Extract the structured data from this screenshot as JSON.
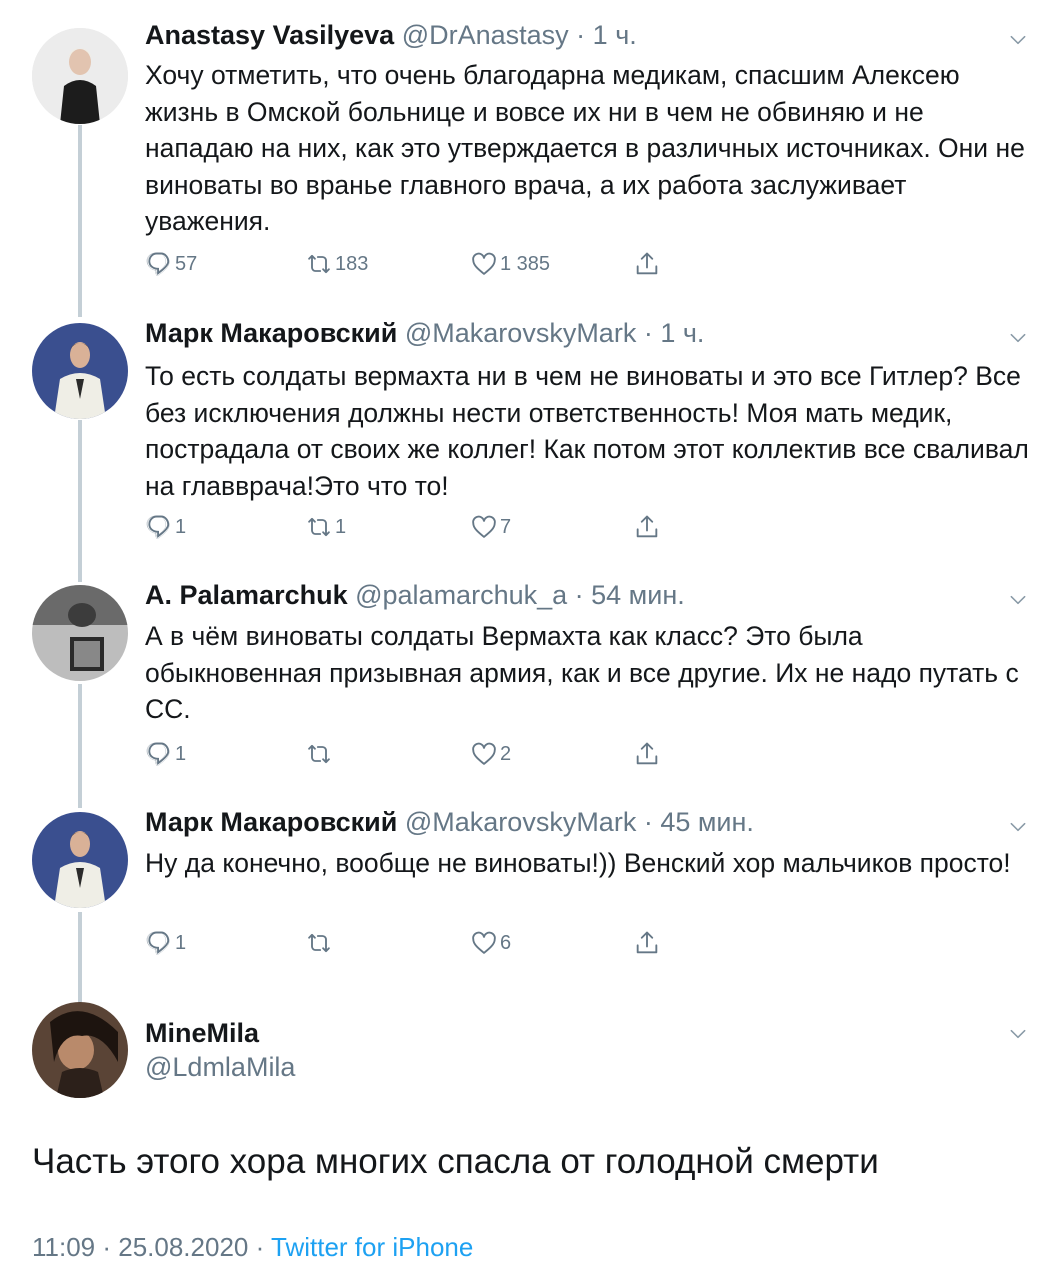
{
  "tweets": [
    {
      "name": "Anastasy Vasilyeva",
      "handle": "@DrAnastasy",
      "sep": " · ",
      "time": "1 ч.",
      "text": "Хочу отметить, что очень благодарна медикам, спасшим Алексею жизнь в Омской больнице и вовсе их ни в чем не обвиняю и не нападаю на них, как это утверждается в различных источниках. Они не виноваты во вранье главного врача, а их работа  заслуживает уважения.",
      "replies": "57",
      "retweets": "183",
      "likes": "1 385"
    },
    {
      "name": "Марк Макаровский",
      "handle": "@MakarovskyMark",
      "sep": " · ",
      "time": "1 ч.",
      "text": "То есть солдаты вермахта ни в чем не виноваты и это все Гитлер? Все без исключения должны нести ответственность! Моя мать медик, пострадала от своих же коллег! Как потом этот коллектив все сваливал на главврача!Это что то!",
      "replies": "1",
      "retweets": "1",
      "likes": "7"
    },
    {
      "name": "A. Palamarchuk",
      "handle": "@palamarchuk_a",
      "sep": " · ",
      "time": "54 мин.",
      "text": "А в чём виноваты солдаты Вермахта как класс? Это была обыкновенная призывная армия, как и все другие. Их не надо путать с СС.",
      "replies": "1",
      "retweets": "",
      "likes": "2"
    },
    {
      "name": "Марк Макаровский",
      "handle": "@MakarovskyMark",
      "sep": " · ",
      "time": "45 мин.",
      "text": "Ну да конечно, вообще не виноваты!)) Венский хор мальчиков просто!",
      "replies": "1",
      "retweets": "",
      "likes": "6"
    }
  ],
  "focused": {
    "name": "MineMila",
    "handle": "@LdmlaMila",
    "text": "Часть этого хора многих спасла от голодной смерти",
    "time": "11:09 · 25.08.2020 · ",
    "source": "Twitter for iPhone"
  },
  "icons": [
    "reply-icon",
    "retweet-icon",
    "like-icon",
    "share-icon",
    "chevron-down-icon"
  ],
  "colors": {
    "text": "#14171a",
    "secondary": "#657786",
    "link": "#1da1f2",
    "thread": "#c4cfd6"
  }
}
